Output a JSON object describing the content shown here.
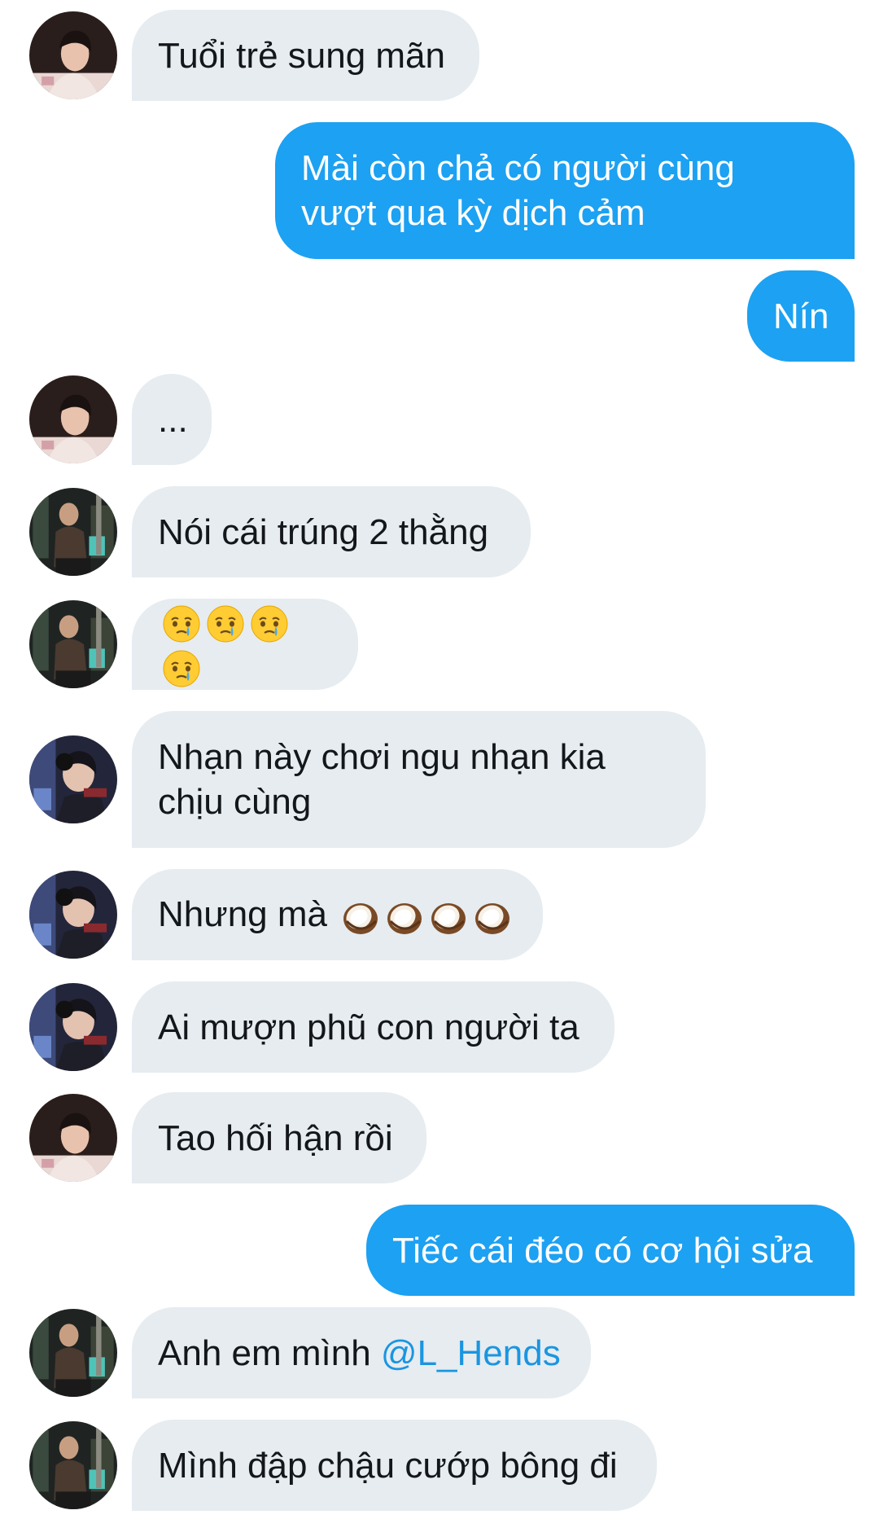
{
  "avatars": {
    "a": "avatar-white-hoodie",
    "b": "avatar-gaming-setup",
    "c": "avatar-headphones"
  },
  "colors": {
    "incoming_bubble": "#e6ecf0",
    "outgoing_bubble": "#1da1f2",
    "mention": "#1b95e0"
  },
  "messages": [
    {
      "direction": "in",
      "avatar": "a",
      "text": "Tuổi trẻ sung mãn"
    },
    {
      "direction": "out",
      "text": "Mài còn chả có người cùng\nvượt qua kỳ dịch cảm"
    },
    {
      "direction": "out",
      "text": "Nín"
    },
    {
      "direction": "in",
      "avatar": "a",
      "text": "..."
    },
    {
      "direction": "in",
      "avatar": "b",
      "text": "Nói cái trúng 2 thằng"
    },
    {
      "direction": "in",
      "avatar": "b",
      "emoji": [
        "face-holding-back-tears",
        "face-holding-back-tears",
        "face-holding-back-tears",
        "face-holding-back-tears"
      ]
    },
    {
      "direction": "in",
      "avatar": "c",
      "text": "Nhạn này chơi ngu nhạn kia\nchịu cùng"
    },
    {
      "direction": "in",
      "avatar": "c",
      "text": "Nhưng mà",
      "emoji": [
        "coconut",
        "coconut",
        "coconut",
        "coconut"
      ]
    },
    {
      "direction": "in",
      "avatar": "c",
      "text": "Ai mượn phũ con người ta"
    },
    {
      "direction": "in",
      "avatar": "a",
      "text": "Tao hối hận rồi"
    },
    {
      "direction": "out",
      "text": "Tiếc cái đéo có cơ hội sửa"
    },
    {
      "direction": "in",
      "avatar": "b",
      "text": "Anh em mình",
      "mention": "@L_Hends"
    },
    {
      "direction": "in",
      "avatar": "b",
      "text": "Mình đập chậu cướp bông đi"
    }
  ]
}
